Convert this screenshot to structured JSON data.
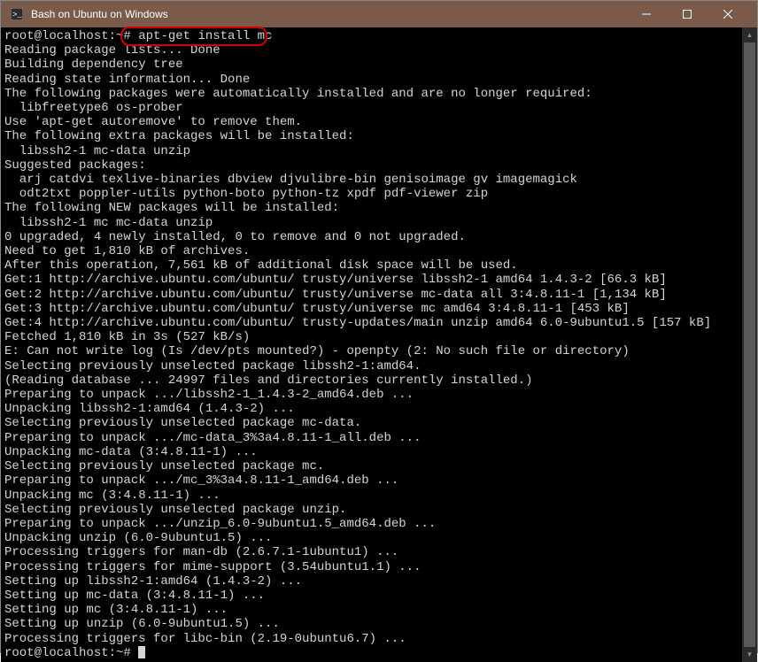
{
  "window": {
    "title": "Bash on Ubuntu on Windows"
  },
  "terminal": {
    "prompt1": "root@localhost:~#",
    "command1": "apt-get install mc",
    "lines": [
      "Reading package lists... Done",
      "Building dependency tree",
      "Reading state information... Done",
      "The following packages were automatically installed and are no longer required:",
      "  libfreetype6 os-prober",
      "Use 'apt-get autoremove' to remove them.",
      "The following extra packages will be installed:",
      "  libssh2-1 mc-data unzip",
      "Suggested packages:",
      "  arj catdvi texlive-binaries dbview djvulibre-bin genisoimage gv imagemagick",
      "  odt2txt poppler-utils python-boto python-tz xpdf pdf-viewer zip",
      "The following NEW packages will be installed:",
      "  libssh2-1 mc mc-data unzip",
      "0 upgraded, 4 newly installed, 0 to remove and 0 not upgraded.",
      "Need to get 1,810 kB of archives.",
      "After this operation, 7,561 kB of additional disk space will be used.",
      "Get:1 http://archive.ubuntu.com/ubuntu/ trusty/universe libssh2-1 amd64 1.4.3-2 [66.3 kB]",
      "Get:2 http://archive.ubuntu.com/ubuntu/ trusty/universe mc-data all 3:4.8.11-1 [1,134 kB]",
      "Get:3 http://archive.ubuntu.com/ubuntu/ trusty/universe mc amd64 3:4.8.11-1 [453 kB]",
      "Get:4 http://archive.ubuntu.com/ubuntu/ trusty-updates/main unzip amd64 6.0-9ubuntu1.5 [157 kB]",
      "Fetched 1,810 kB in 3s (527 kB/s)",
      "E: Can not write log (Is /dev/pts mounted?) - openpty (2: No such file or directory)",
      "Selecting previously unselected package libssh2-1:amd64.",
      "(Reading database ... 24997 files and directories currently installed.)",
      "Preparing to unpack .../libssh2-1_1.4.3-2_amd64.deb ...",
      "Unpacking libssh2-1:amd64 (1.4.3-2) ...",
      "Selecting previously unselected package mc-data.",
      "Preparing to unpack .../mc-data_3%3a4.8.11-1_all.deb ...",
      "Unpacking mc-data (3:4.8.11-1) ...",
      "Selecting previously unselected package mc.",
      "Preparing to unpack .../mc_3%3a4.8.11-1_amd64.deb ...",
      "Unpacking mc (3:4.8.11-1) ...",
      "Selecting previously unselected package unzip.",
      "Preparing to unpack .../unzip_6.0-9ubuntu1.5_amd64.deb ...",
      "Unpacking unzip (6.0-9ubuntu1.5) ...",
      "Processing triggers for man-db (2.6.7.1-1ubuntu1) ...",
      "Processing triggers for mime-support (3.54ubuntu1.1) ...",
      "Setting up libssh2-1:amd64 (1.4.3-2) ...",
      "Setting up mc-data (3:4.8.11-1) ...",
      "Setting up mc (3:4.8.11-1) ...",
      "Setting up unzip (6.0-9ubuntu1.5) ...",
      "Processing triggers for libc-bin (2.19-0ubuntu6.7) ..."
    ],
    "prompt2": "root@localhost:~#"
  }
}
